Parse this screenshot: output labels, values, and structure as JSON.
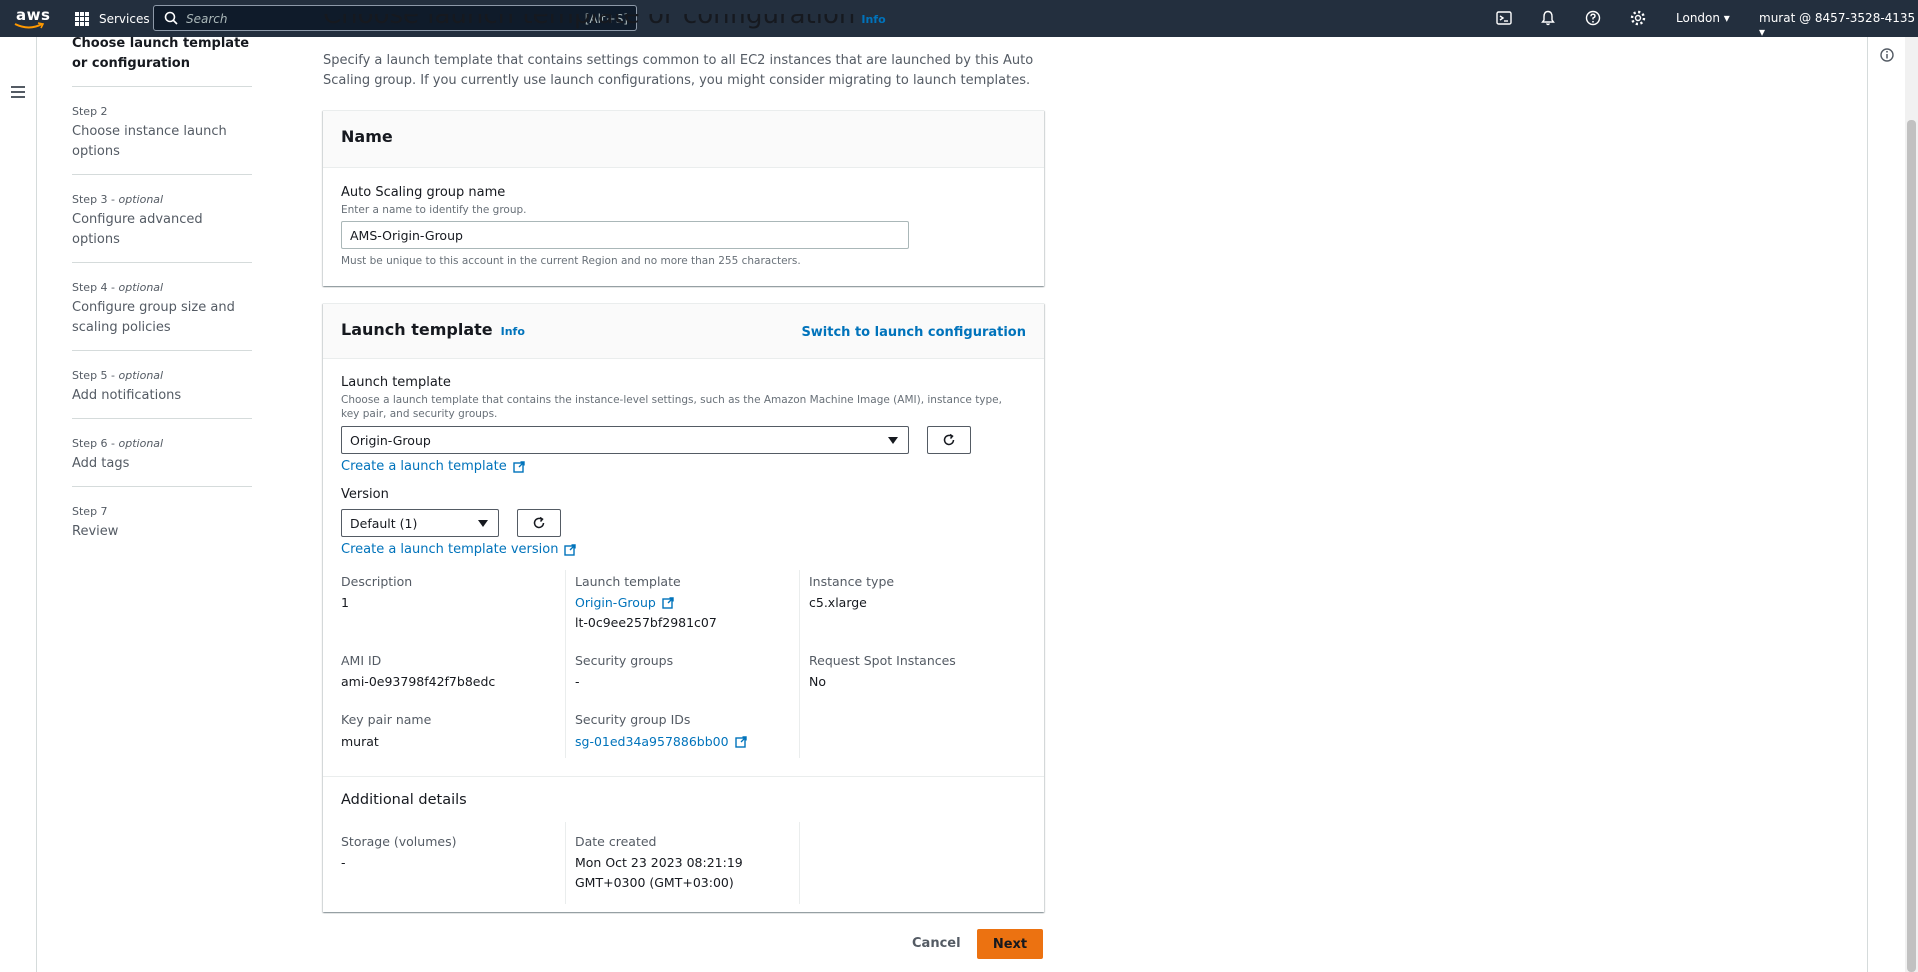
{
  "topnav": {
    "logo_text": "aws",
    "services_label": "Services",
    "search_placeholder": "Search",
    "search_shortcut": "[Alt+S]",
    "region": "London ▾",
    "account": "murat @ 8457-3528-4135 ▾"
  },
  "steps": [
    {
      "number": "",
      "title": "Choose launch template or configuration",
      "active": true
    },
    {
      "number": "Step 2",
      "optional": "",
      "title": "Choose instance launch options"
    },
    {
      "number": "Step 3 - ",
      "optional": "optional",
      "title": "Configure advanced options"
    },
    {
      "number": "Step 4 - ",
      "optional": "optional",
      "title": "Configure group size and scaling policies"
    },
    {
      "number": "Step 5 - ",
      "optional": "optional",
      "title": "Add notifications"
    },
    {
      "number": "Step 6 - ",
      "optional": "optional",
      "title": "Add tags"
    },
    {
      "number": "Step 7",
      "optional": "",
      "title": "Review"
    }
  ],
  "page": {
    "title": "Choose launch template or configuration",
    "title_info": "Info",
    "description": "Specify a launch template that contains settings common to all EC2 instances that are launched by this Auto Scaling group. If you currently use launch configurations, you might consider migrating to launch templates."
  },
  "name_card": {
    "header": "Name",
    "field_label": "Auto Scaling group name",
    "field_hint": "Enter a name to identify the group.",
    "field_value": "AMS-Origin-Group",
    "constraint": "Must be unique to this account in the current Region and no more than 255 characters."
  },
  "launch_card": {
    "header": "Launch template",
    "header_info": "Info",
    "switch_link": "Switch to launch configuration",
    "template_label": "Launch template",
    "template_hint": "Choose a launch template that contains the instance-level settings, such as the Amazon Machine Image (AMI), instance type, key pair, and security groups.",
    "template_value": "Origin-Group",
    "create_template_link": "Create a launch template",
    "version_label": "Version",
    "version_value": "Default (1)",
    "create_version_link": "Create a launch template version",
    "details": {
      "description_key": "Description",
      "description_val": "1",
      "lt_key": "Launch template",
      "lt_link": "Origin-Group",
      "lt_id": "lt-0c9ee257bf2981c07",
      "instance_type_key": "Instance type",
      "instance_type_val": "c5.xlarge",
      "ami_key": "AMI ID",
      "ami_val": "ami-0e93798f42f7b8edc",
      "sg_key": "Security groups",
      "sg_val": "-",
      "spot_key": "Request Spot Instances",
      "spot_val": "No",
      "keypair_key": "Key pair name",
      "keypair_val": "murat",
      "sgid_key": "Security group IDs",
      "sgid_link": "sg-01ed34a957886bb00"
    },
    "additional_header": "Additional details",
    "storage_key": "Storage (volumes)",
    "storage_val": "-",
    "date_key": "Date created",
    "date_val_1": "Mon Oct 23 2023 08:21:19",
    "date_val_2": "GMT+0300 (GMT+03:00)"
  },
  "footer": {
    "cancel": "Cancel",
    "next": "Next"
  }
}
